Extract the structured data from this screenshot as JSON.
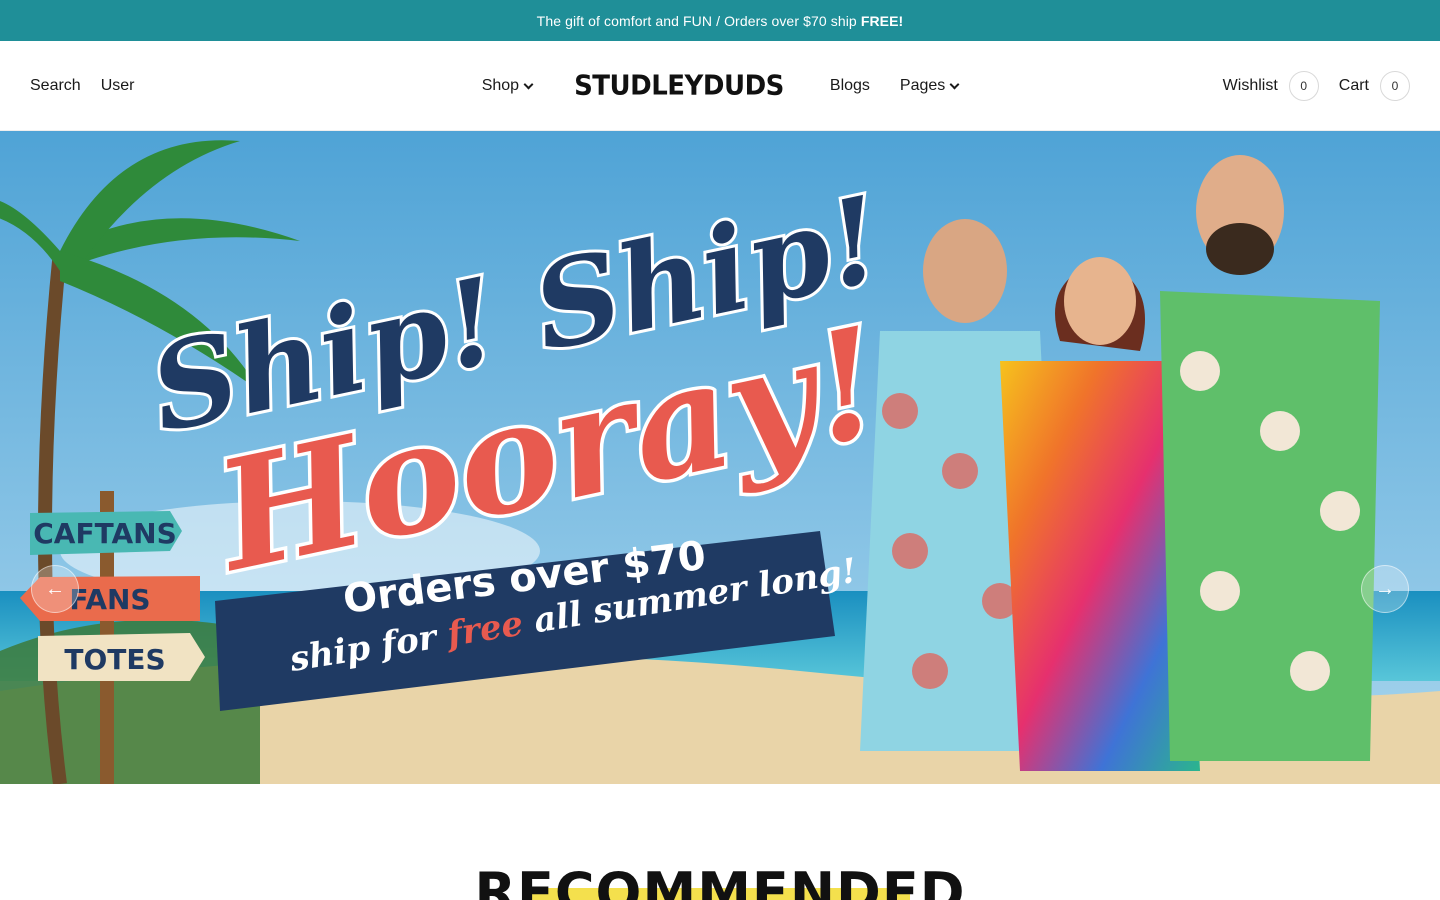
{
  "announcement": {
    "text": "The gift of comfort and FUN / Orders over $70 ship",
    "bold": "FREE!"
  },
  "header": {
    "search_label": "Search",
    "user_label": "User",
    "nav": {
      "shop": "Shop",
      "blogs": "Blogs",
      "pages": "Pages"
    },
    "logo": {
      "part1": "STUDLEY",
      "part2": "DUDS"
    },
    "wishlist_label": "Wishlist",
    "wishlist_count": "0",
    "cart_label": "Cart",
    "cart_count": "0"
  },
  "hero": {
    "headline_line1": "Ship! Ship!",
    "headline_line2": "Hooray!",
    "banner_line1": "Orders over $70",
    "banner_line2_a": "ship for",
    "banner_line2_free": "free",
    "banner_line2_b": "all summer long!",
    "signs": [
      "CAFTANS",
      "FANS",
      "TOTES"
    ],
    "prev_icon": "arrow-left-icon",
    "next_icon": "arrow-right-icon",
    "colors": {
      "navy": "#1f3a63",
      "coral": "#e85a4f",
      "sky": "#5aa9d8",
      "sand": "#ead6ad",
      "sea": "#1e9cc8"
    }
  },
  "section": {
    "title": "RECOMMENDED"
  }
}
